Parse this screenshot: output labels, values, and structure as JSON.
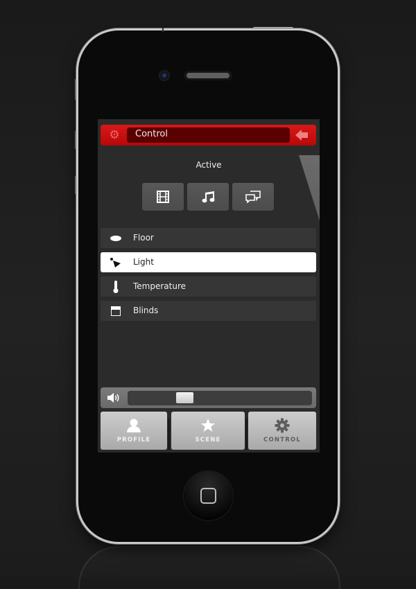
{
  "header": {
    "title": "Control",
    "left_icon": "gear-icon",
    "right_icon": "back-arrow-icon",
    "accent": "#c80f0f"
  },
  "status": {
    "label": "Active"
  },
  "modes": [
    {
      "icon": "film-icon",
      "name": "Movie"
    },
    {
      "icon": "music-note-icon",
      "name": "Music"
    },
    {
      "icon": "chat-icon",
      "name": "Chat"
    }
  ],
  "list": [
    {
      "label": "Floor",
      "icon": "floor-icon",
      "selected": false
    },
    {
      "label": "Light",
      "icon": "lamp-icon",
      "selected": true
    },
    {
      "label": "Temperature",
      "icon": "thermometer-icon",
      "selected": false
    },
    {
      "label": "Blinds",
      "icon": "blinds-icon",
      "selected": false
    }
  ],
  "volume": {
    "icon": "speaker-icon",
    "level_percent": 29
  },
  "tabs": [
    {
      "label": "PROFILE",
      "icon": "user-icon",
      "active": false
    },
    {
      "label": "SCENE",
      "icon": "star-icon",
      "active": false
    },
    {
      "label": "CONTROL",
      "icon": "gear-icon",
      "active": true
    }
  ]
}
